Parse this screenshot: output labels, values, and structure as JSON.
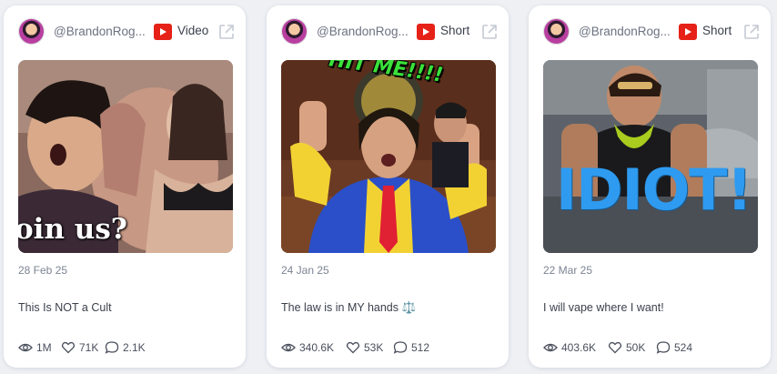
{
  "cards": [
    {
      "handle": "@BrandonRog...",
      "platform_icon": "youtube-icon",
      "type": "Video",
      "thumbnail_caption": "oin us?",
      "date": "28 Feb 25",
      "title": "This Is NOT a Cult",
      "views": "1M",
      "likes": "71K",
      "comments": "2.1K"
    },
    {
      "handle": "@BrandonRog...",
      "platform_icon": "youtube-icon",
      "type": "Short",
      "thumbnail_caption": "HIT ME!!!!",
      "date": "24 Jan 25",
      "title": "The law is in MY hands ⚖️",
      "views": "340.6K",
      "likes": "53K",
      "comments": "512"
    },
    {
      "handle": "@BrandonRog...",
      "platform_icon": "youtube-icon",
      "type": "Short",
      "thumbnail_caption": "IDIOT!",
      "date": "22 Mar 25",
      "title": "I will vape where I want!",
      "views": "403.6K",
      "likes": "50K",
      "comments": "524"
    }
  ],
  "colors": {
    "youtube_red": "#e62117",
    "card_bg": "#ffffff",
    "page_bg": "#eef0f4"
  }
}
